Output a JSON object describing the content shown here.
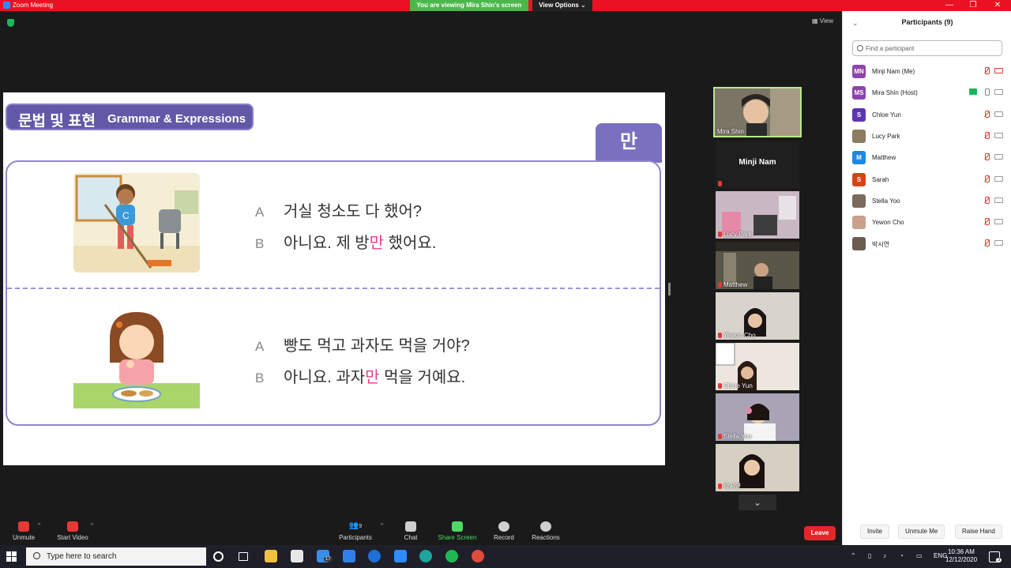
{
  "window": {
    "title": "Zoom Meeting",
    "viewing_banner": "You are viewing Mira Shin's screen",
    "view_options": "View Options ⌄",
    "view_label": "View",
    "minimize": "—",
    "restore": "❐",
    "close": "✕"
  },
  "slide": {
    "badge_ko": "문법 및 표현",
    "badge_en": "Grammar & Expressions",
    "tab": "만",
    "dialog1": {
      "a_label": "A",
      "a_text": "거실 청소도 다 했어?",
      "b_label": "B",
      "b_pre": "아니요. 제 방",
      "b_hl": "만",
      "b_post": " 했어요."
    },
    "dialog2": {
      "a_label": "A",
      "a_text": "빵도 먹고 과자도 먹을 거야?",
      "b_label": "B",
      "b_pre": "아니요. 과자",
      "b_hl": "만",
      "b_post": " 먹을 거예요."
    }
  },
  "video_tiles": [
    {
      "name": "Mira Shin"
    },
    {
      "name": "Minji Nam"
    },
    {
      "name": "Lucy Park"
    },
    {
      "name": "Matthew"
    },
    {
      "name": "Yewon Cho"
    },
    {
      "name": "Chloe Yun"
    },
    {
      "name": "Stella Yoo"
    },
    {
      "name": "박시연"
    }
  ],
  "participants_panel": {
    "title": "Participants (9)",
    "search_placeholder": "Find a participant",
    "participants": [
      {
        "initials": "MN",
        "name": "Minji Nam (Me)",
        "color": "#8e44ad"
      },
      {
        "initials": "MS",
        "name": "Mira Shin (Host)",
        "color": "#8e44ad"
      },
      {
        "initials": "S",
        "name": "Chloe Yun",
        "color": "#5e35b1"
      },
      {
        "initials": "",
        "name": "Lucy Park",
        "color": "#8d7b62"
      },
      {
        "initials": "M",
        "name": "Matthew",
        "color": "#1e88e5"
      },
      {
        "initials": "S",
        "name": "Sarah",
        "color": "#d84315"
      },
      {
        "initials": "",
        "name": "Stella Yoo",
        "color": "#7a6a5a"
      },
      {
        "initials": "",
        "name": "Yewon Cho",
        "color": "#c9a08c"
      },
      {
        "initials": "",
        "name": "박시연",
        "color": "#6d5d50"
      }
    ],
    "invite": "Invite",
    "unmute_me": "Unmute Me",
    "raise_hand": "Raise Hand"
  },
  "toolbar": {
    "unmute": "Unmute",
    "start_video": "Start Video",
    "participants": "Participants",
    "participants_count": "9",
    "chat": "Chat",
    "share_screen": "Share Screen",
    "record": "Record",
    "reactions": "Reactions",
    "leave": "Leave"
  },
  "taskbar": {
    "search_placeholder": "Type here to search",
    "mail_badge": "17",
    "lang": "ENG",
    "time": "10:36 AM",
    "date": "12/12/2020",
    "notif_count": "3"
  }
}
